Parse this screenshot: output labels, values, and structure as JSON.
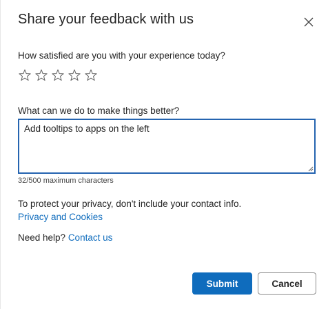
{
  "dialog": {
    "title": "Share your feedback with us",
    "close_icon": "close-icon"
  },
  "rating": {
    "question": "How satisfied are you with your experience today?",
    "max_stars": 5,
    "selected_stars": 0,
    "star_icon": "star-outline-icon"
  },
  "feedback": {
    "question": "What can we do to make things better?",
    "value": "Add tooltips to apps on the left",
    "char_count": "32/500 maximum characters"
  },
  "privacy": {
    "notice": "To protect your privacy, don't include your contact info.",
    "link_label": "Privacy and Cookies"
  },
  "help": {
    "prefix": "Need help?",
    "link_label": "Contact us"
  },
  "actions": {
    "submit_label": "Submit",
    "cancel_label": "Cancel"
  },
  "colors": {
    "accent": "#0f6cbd",
    "text": "#242424",
    "focus_border": "#2564b0"
  }
}
